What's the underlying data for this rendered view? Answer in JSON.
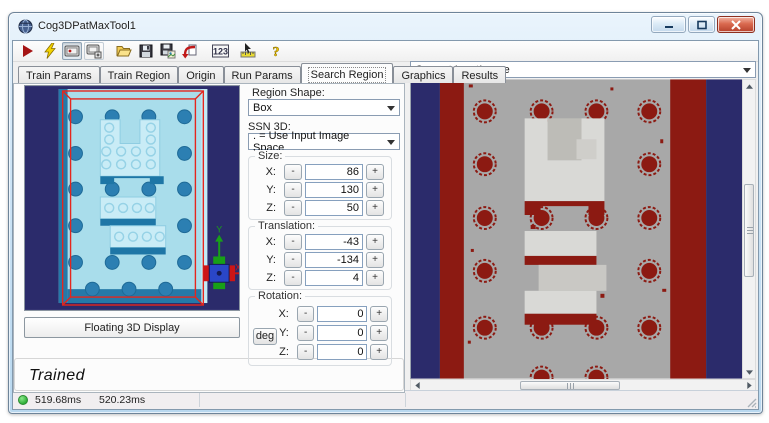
{
  "window": {
    "title": "Cog3DPatMaxTool1"
  },
  "toolbar": {
    "icons": [
      "run-icon",
      "lightning-icon",
      "display-toggle-icon",
      "display-copy-icon",
      "open-folder-icon",
      "save-icon",
      "save-image-icon",
      "reset-icon",
      "results-123-icon",
      "measure-icon",
      "help-icon"
    ]
  },
  "tabs": {
    "items": [
      "Train Params",
      "Train Region",
      "Origin",
      "Run Params",
      "Search Region",
      "Graphics",
      "Results"
    ],
    "active": "Search Region"
  },
  "left_panel": {
    "floating_display_button": "Floating 3D Display",
    "trained_status": "Trained",
    "axis_x_label": "X",
    "axis_y_label": "Y"
  },
  "form": {
    "region_shape_label": "Region Shape:",
    "region_shape_value": "Box",
    "ssn3d_label": "SSN 3D:",
    "ssn3d_value": ". = Use Input Image Space",
    "minus_label": "-",
    "plus_label": "+",
    "deg_button_label": "deg",
    "size": {
      "label": "Size:",
      "rows": [
        {
          "axis": "X:",
          "value": "86"
        },
        {
          "axis": "Y:",
          "value": "130"
        },
        {
          "axis": "Z:",
          "value": "50"
        }
      ]
    },
    "translation": {
      "label": "Translation:",
      "rows": [
        {
          "axis": "X:",
          "value": "-43"
        },
        {
          "axis": "Y:",
          "value": "-134"
        },
        {
          "axis": "Z:",
          "value": "4"
        }
      ]
    },
    "rotation": {
      "label": "Rotation:",
      "rows": [
        {
          "axis": "X:",
          "value": "0"
        },
        {
          "axis": "Y:",
          "value": "0"
        },
        {
          "axis": "Z:",
          "value": "0"
        }
      ]
    }
  },
  "right_panel": {
    "image_selector_value": "Current.InputImage"
  },
  "status_bar": {
    "time_1": "519.68ms",
    "time_2": "520.23ms"
  },
  "colors": {
    "viewport_navy": "#2b2b6b",
    "band_red": "#8c1a12",
    "image_gray": "#a8a8a8",
    "plate_cyan": "#a9ddeb",
    "stud_blue": "#2c7fb2",
    "brick_cyan": "#c9ecf6",
    "wireframe_red": "#e5261d",
    "status_green": "#2fae38"
  }
}
